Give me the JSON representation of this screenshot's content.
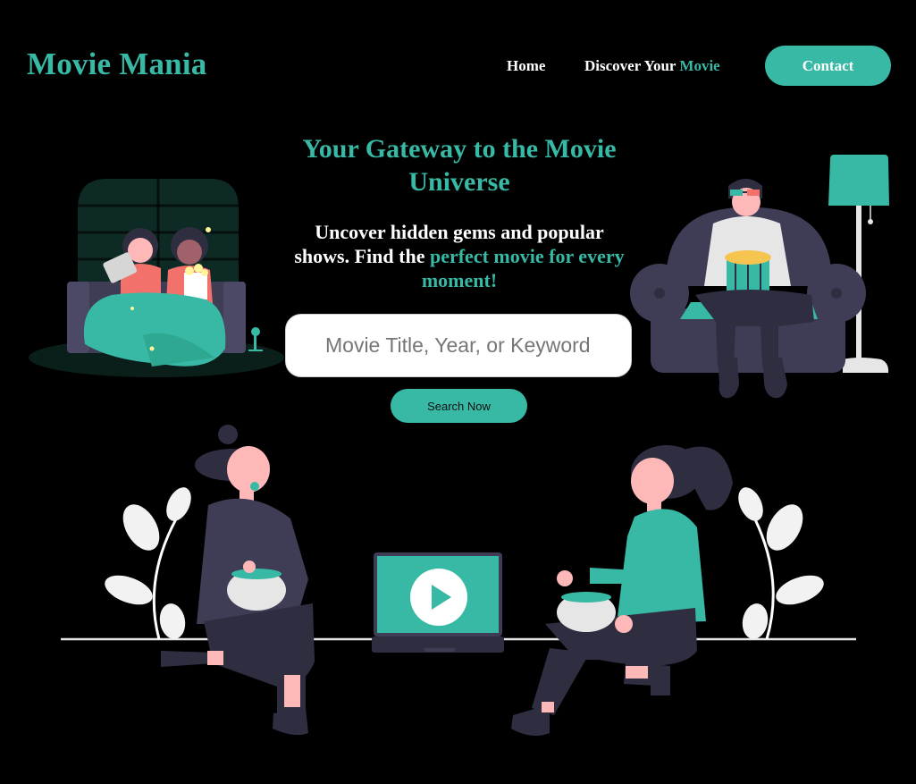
{
  "brand": {
    "name": "Movie Mania"
  },
  "nav": {
    "home": "Home",
    "discover_prefix": "Discover Your ",
    "discover_accent": "Movie",
    "contact": "Contact"
  },
  "hero": {
    "title": "Your Gateway to the Movie Universe",
    "subtitle_plain": "Uncover hidden gems and popular shows. Find the ",
    "subtitle_accent": "perfect movie for every moment!"
  },
  "search": {
    "placeholder": "Movie Title, Year, or Keyword",
    "value": "",
    "button_label": "Search Now"
  },
  "colors": {
    "background": "#000000",
    "accent": "#38b9a5",
    "text": "#ffffff",
    "dark_figure": "#3f3d56",
    "skin": "#ffb8b8"
  },
  "icons": [
    "play-icon",
    "laptop-icon",
    "popcorn-bowl-icon",
    "floor-lamp-icon",
    "plant-icon",
    "sofa-icon",
    "armchair-icon"
  ]
}
